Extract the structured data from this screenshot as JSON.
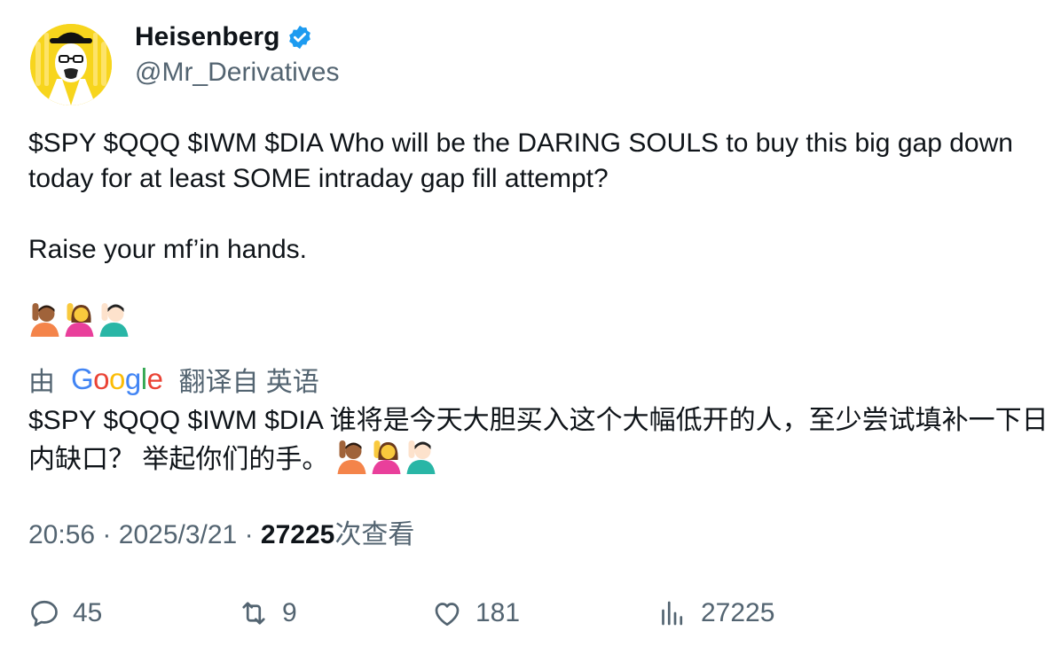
{
  "user": {
    "display_name": "Heisenberg",
    "handle": "@Mr_Derivatives",
    "verified_icon": "verified-badge-icon",
    "badge_color": "#1d9bf0"
  },
  "tweet": {
    "text": "$SPY $QQQ $IWM $DIA Who will be the DARING SOULS to buy this big gap down today for at least SOME intraday gap fill attempt?\n\nRaise your mf’in hands.",
    "emojis": [
      "person-raising-hand-medium-dark",
      "woman-raising-hand",
      "man-raising-hand-light"
    ]
  },
  "translation": {
    "prefix": "由",
    "provider": "Google",
    "label": "翻译自 英语",
    "text": "$SPY $QQQ $IWM $DIA 谁将是今天大胆买入这个大幅低开的人，至少尝试填补一下日内缺口？ 举起你们的手。"
  },
  "meta": {
    "time": "20:56",
    "sep1": "·",
    "date": "2025/3/21",
    "sep2": "·",
    "views": "27225",
    "views_label": "次查看"
  },
  "actions": {
    "replies": "45",
    "retweets": "9",
    "likes": "181",
    "views": "27225"
  },
  "colors": {
    "text": "#0f1419",
    "secondary": "#536471",
    "google_blue": "#4285f4",
    "google_red": "#ea4335",
    "google_yellow": "#fbbc05",
    "google_green": "#34a853"
  }
}
